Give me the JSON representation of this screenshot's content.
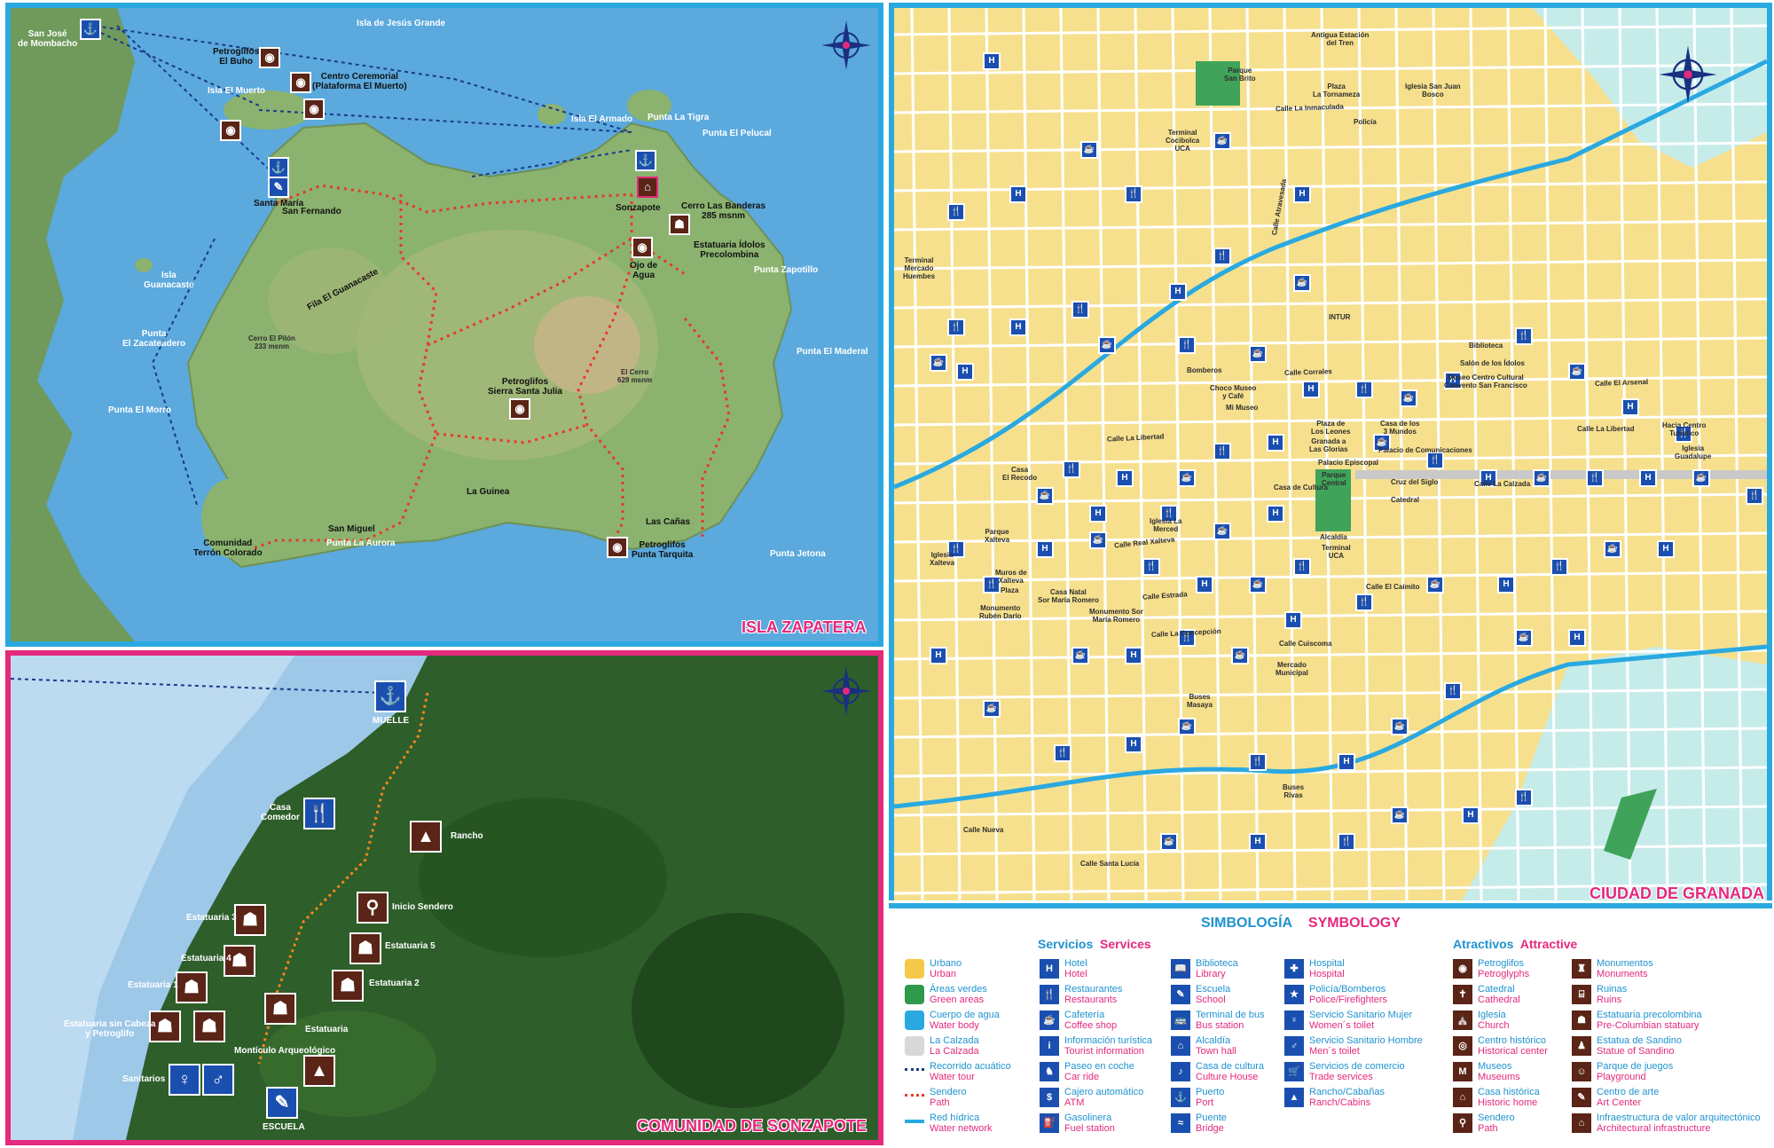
{
  "colors": {
    "blue_frame": "#2aa9e0",
    "pink_frame": "#e5297c",
    "water": "#5ba9dd",
    "land": "#7fa86a",
    "urban": "#f6e08e",
    "service_icon": "#1a4fb0",
    "attraction_icon": "#5a2417",
    "path": "#e53a2a"
  },
  "zapatera": {
    "title": "ISLA ZAPATERA",
    "places": [
      {
        "id": "sanjose",
        "text": "San José\nde Mombacho"
      },
      {
        "id": "jesus",
        "text": "Isla de Jesús Grande"
      },
      {
        "id": "buho",
        "text": "Petroglifos\nEl Buho"
      },
      {
        "id": "ceremonial",
        "text": "Centro Ceremorial\n(Plataforma El Muerto)"
      },
      {
        "id": "muerto",
        "text": "Isla El Muerto"
      },
      {
        "id": "armado",
        "text": "Isla El Armado"
      },
      {
        "id": "tigra",
        "text": "Punta La Tigra"
      },
      {
        "id": "pelucal",
        "text": "Punta El Pelucal"
      },
      {
        "id": "santamaria",
        "text": "Santa María"
      },
      {
        "id": "sanfernando",
        "text": "San Fernando"
      },
      {
        "id": "sonzapote",
        "text": "Sonzapote"
      },
      {
        "id": "banderas",
        "text": "Cerro Las Banderas\n285 msnm"
      },
      {
        "id": "idolos",
        "text": "Estatuaria Ídolos\nPrecolombina"
      },
      {
        "id": "ojo",
        "text": "Ojo de\nAgua"
      },
      {
        "id": "zapotillo",
        "text": "Punta Zapotillo"
      },
      {
        "id": "guanacaste",
        "text": "Isla\nGuanacaste"
      },
      {
        "id": "fila",
        "text": "Fila El Guanacaste"
      },
      {
        "id": "zacate",
        "text": "Punta\nEl Zacateadero"
      },
      {
        "id": "pilon",
        "text": "Cerro El Pilón\n233 msnm"
      },
      {
        "id": "cerro",
        "text": "El Cerro\n629 msnm"
      },
      {
        "id": "madera",
        "text": "Punta El Maderal"
      },
      {
        "id": "morro",
        "text": "Punta El Morro"
      },
      {
        "id": "julia",
        "text": "Petroglifos\nSierra Santa Julia"
      },
      {
        "id": "guinea",
        "text": "La Guinea"
      },
      {
        "id": "canas",
        "text": "Las Cañas"
      },
      {
        "id": "sanmiguel",
        "text": "San Miguel"
      },
      {
        "id": "terron",
        "text": "Comunidad\nTerrón Colorado"
      },
      {
        "id": "aurora",
        "text": "Punta La Aurora"
      },
      {
        "id": "tarquita",
        "text": "Petroglifos\nPunta Tarquita"
      },
      {
        "id": "jetona",
        "text": "Punta Jetona"
      }
    ]
  },
  "sonzapote": {
    "title": "COMUNIDAD DE SONZAPOTE",
    "places": [
      {
        "id": "muelle",
        "text": "MUELLE"
      },
      {
        "id": "comedor",
        "text": "Casa\nComedor"
      },
      {
        "id": "rancho",
        "text": "Rancho"
      },
      {
        "id": "inicio",
        "text": "Inicio Sendero"
      },
      {
        "id": "e3",
        "text": "Estatuaria 3"
      },
      {
        "id": "e5",
        "text": "Estatuaria 5"
      },
      {
        "id": "e4",
        "text": "Estatuaria 4"
      },
      {
        "id": "e1",
        "text": "Estatuaria 1"
      },
      {
        "id": "e2",
        "text": "Estatuaria 2"
      },
      {
        "id": "esc",
        "text": "Estatuaria sin Cabeza\ny Petroglifo"
      },
      {
        "id": "est",
        "text": "Estatuaria"
      },
      {
        "id": "mont",
        "text": "Montículo Arqueológico"
      },
      {
        "id": "sanit",
        "text": "Sanitarios"
      },
      {
        "id": "escuela",
        "text": "ESCUELA"
      }
    ]
  },
  "granada": {
    "title": "CIUDAD DE GRANADA",
    "places": [
      {
        "id": "estacion",
        "text": "Antigua Estación\ndel Tren"
      },
      {
        "id": "sanbrito",
        "text": "Parque\nSan Brito"
      },
      {
        "id": "tornameza",
        "text": "Plaza\nLa Tornameza"
      },
      {
        "id": "sanjuan",
        "text": "Iglesia San Juan\nBosco"
      },
      {
        "id": "cocibolca",
        "text": "Terminal\nCocibolca\nUCA"
      },
      {
        "id": "policia",
        "text": "Policía"
      },
      {
        "id": "huembes",
        "text": "Terminal\nMercado\nHuembes"
      },
      {
        "id": "intur",
        "text": "INTUR"
      },
      {
        "id": "biblioteca",
        "text": "Biblioteca"
      },
      {
        "id": "idolos",
        "text": "Salón de los Ídolos"
      },
      {
        "id": "convento",
        "text": "Museo Centro Cultural\nConvento San Francisco"
      },
      {
        "id": "bomberos",
        "text": "Bomberos"
      },
      {
        "id": "choco",
        "text": "Choco Museo\ny Café"
      },
      {
        "id": "mimuseo",
        "text": "Mi Museo"
      },
      {
        "id": "leones",
        "text": "Plaza de\nLos Leones"
      },
      {
        "id": "mundos",
        "text": "Casa de los\n3 Mundos"
      },
      {
        "id": "glorias",
        "text": "Granada a\nLas Glorias"
      },
      {
        "id": "comunicaciones",
        "text": "Palacio de Comunicaciones"
      },
      {
        "id": "episcopal",
        "text": "Palacio Episcopal"
      },
      {
        "id": "parque",
        "text": "Parque\nCentral"
      },
      {
        "id": "cruz",
        "text": "Cruz del Siglo"
      },
      {
        "id": "catedral",
        "text": "Catedral"
      },
      {
        "id": "recodo",
        "text": "Casa\nEl Recodo"
      },
      {
        "id": "cultura",
        "text": "Casa de Cultura"
      },
      {
        "id": "merced",
        "text": "Iglesia La\nMerced"
      },
      {
        "id": "alcaldia",
        "text": "Alcaldía"
      },
      {
        "id": "terminaluca",
        "text": "Terminal\nUCA"
      },
      {
        "id": "xalteva",
        "text": "Parque\nXalteva"
      },
      {
        "id": "igxalteva",
        "text": "Iglesia\nXalteva"
      },
      {
        "id": "muros",
        "text": "Muros de\nXalteva"
      },
      {
        "id": "plaza",
        "text": "Plaza"
      },
      {
        "id": "dario",
        "text": "Monumento\nRubén Darío"
      },
      {
        "id": "natal",
        "text": "Casa Natal\nSor María Romero"
      },
      {
        "id": "monsor",
        "text": "Monumento Sor\nMaría Romero"
      },
      {
        "id": "mercado",
        "text": "Mercado\nMunicipal"
      },
      {
        "id": "masaya",
        "text": "Buses\nMasaya"
      },
      {
        "id": "rivas",
        "text": "Buses\nRivas"
      },
      {
        "id": "turistico",
        "text": "Hacia Centro\nTurístico"
      },
      {
        "id": "guadalupe",
        "text": "Iglesia\nGuadalupe"
      }
    ],
    "streets": [
      {
        "id": "s1",
        "text": "Calle La Inmaculada"
      },
      {
        "id": "s2",
        "text": "Calle Corrales"
      },
      {
        "id": "s3",
        "text": "Calle El Arsenal"
      },
      {
        "id": "s4",
        "text": "Calle La Libertad"
      },
      {
        "id": "s5",
        "text": "Calle La Calzada"
      },
      {
        "id": "s6",
        "text": "Calle Real Xalteva"
      },
      {
        "id": "s7",
        "text": "Calle Estrada"
      },
      {
        "id": "s8",
        "text": "Calle La Concepción"
      },
      {
        "id": "s9",
        "text": "Calle Nueva"
      },
      {
        "id": "s10",
        "text": "Calle Cuiscoma"
      },
      {
        "id": "s11",
        "text": "Calle El Caimito"
      },
      {
        "id": "s12",
        "text": "Calle Atravesada"
      },
      {
        "id": "s13",
        "text": "Calle Santa Lucía"
      },
      {
        "id": "s14",
        "text": "Calle La Libertad"
      }
    ]
  },
  "legend": {
    "title_es": "SIMBOLOGÍA",
    "title_en": "SYMBOLOGY",
    "services_es": "Servicios",
    "services_en": "Services",
    "attract_es": "Atractivos",
    "attract_en": "Attractive",
    "col1": [
      {
        "es": "Urbano",
        "en": "Urban",
        "sym": "urban"
      },
      {
        "es": "Áreas verdes",
        "en": "Green areas",
        "sym": "green"
      },
      {
        "es": "Cuerpo de agua",
        "en": "Water body",
        "sym": "water"
      },
      {
        "es": "La Calzada",
        "en": "La Calzada",
        "sym": "calzada"
      },
      {
        "es": "Recorrido acuático",
        "en": "Water tour",
        "sym": "watertour"
      },
      {
        "es": "Sendero",
        "en": "Path",
        "sym": "path"
      },
      {
        "es": "Red hídrica",
        "en": "Water network",
        "sym": "network"
      }
    ],
    "col2": [
      {
        "es": "Hotel",
        "en": "Hotel",
        "sym": "H"
      },
      {
        "es": "Restaurantes",
        "en": "Restaurants",
        "sym": "🍴"
      },
      {
        "es": "Cafetería",
        "en": "Coffee shop",
        "sym": "☕"
      },
      {
        "es": "Información turística",
        "en": "Tourist information",
        "sym": "i"
      },
      {
        "es": "Paseo en coche",
        "en": "Car ride",
        "sym": "♞"
      },
      {
        "es": "Cajero automático",
        "en": "ATM",
        "sym": "$"
      },
      {
        "es": "Gasolinera",
        "en": "Fuel station",
        "sym": "⛽"
      }
    ],
    "col3": [
      {
        "es": "Biblioteca",
        "en": "Library",
        "sym": "📖"
      },
      {
        "es": "Escuela",
        "en": "School",
        "sym": "✎"
      },
      {
        "es": "Terminal de bus",
        "en": "Bus station",
        "sym": "🚌"
      },
      {
        "es": "Alcaldía",
        "en": "Town hall",
        "sym": "⌂"
      },
      {
        "es": "Casa de cultura",
        "en": "Culture House",
        "sym": "♪"
      },
      {
        "es": "Puerto",
        "en": "Port",
        "sym": "⚓"
      },
      {
        "es": "Puente",
        "en": "Bridge",
        "sym": "≈"
      }
    ],
    "col4": [
      {
        "es": "Hospital",
        "en": "Hospital",
        "sym": "✚"
      },
      {
        "es": "Policía/Bomberos",
        "en": "Police/Firefighters",
        "sym": "★"
      },
      {
        "es": "Servicio Sanitario Mujer",
        "en": "Women´s toilet",
        "sym": "♀"
      },
      {
        "es": "Servicio Sanitario Hombre",
        "en": "Men´s toilet",
        "sym": "♂"
      },
      {
        "es": "Servicios de comercio",
        "en": "Trade services",
        "sym": "🛒"
      },
      {
        "es": "Rancho/Cabañas",
        "en": "Ranch/Cabins",
        "sym": "▲"
      }
    ],
    "col5": [
      {
        "es": "Petroglifos",
        "en": "Petroglyphs",
        "sym": "◉"
      },
      {
        "es": "Catedral",
        "en": "Cathedral",
        "sym": "✝"
      },
      {
        "es": "Iglesia",
        "en": "Church",
        "sym": "⛪"
      },
      {
        "es": "Centro histórico",
        "en": "Historical center",
        "sym": "◎"
      },
      {
        "es": "Museos",
        "en": "Museums",
        "sym": "M"
      },
      {
        "es": "Casa histórica",
        "en": "Historic home",
        "sym": "⌂"
      },
      {
        "es": "Sendero",
        "en": "Path",
        "sym": "⚲"
      }
    ],
    "col6": [
      {
        "es": "Monumentos",
        "en": "Monuments",
        "sym": "♜"
      },
      {
        "es": "Ruinas",
        "en": "Ruins",
        "sym": "⌸"
      },
      {
        "es": "Estatuaria precolombina",
        "en": "Pre-Columbian statuary",
        "sym": "☗"
      },
      {
        "es": "Estatua de Sandino",
        "en": "Statue of Sandino",
        "sym": "♟"
      },
      {
        "es": "Parque de juegos",
        "en": "Playground",
        "sym": "☺"
      },
      {
        "es": "Centro de arte",
        "en": "Art Center",
        "sym": "✎"
      },
      {
        "es": "Infraestructura de valor arquitectónico",
        "en": "Architectural infrastructure",
        "sym": "⌂"
      }
    ]
  }
}
